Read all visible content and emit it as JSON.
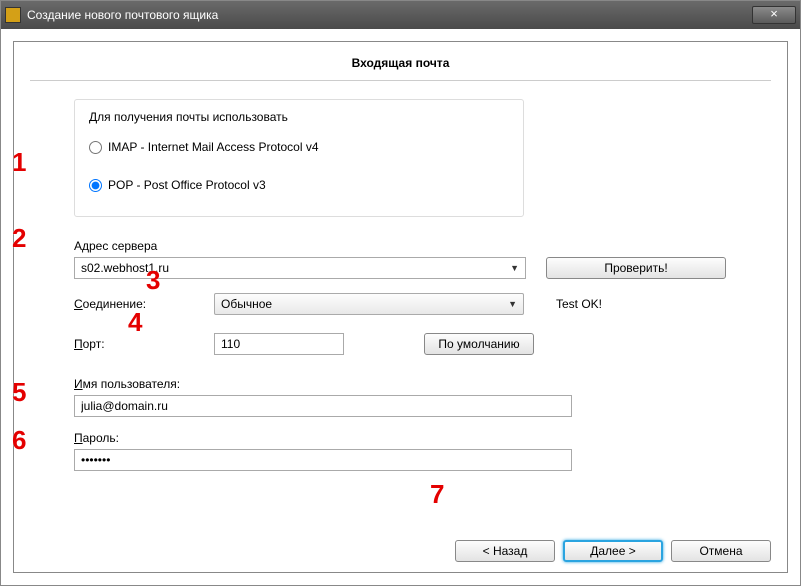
{
  "window": {
    "title": "Создание нового почтового ящика",
    "close": "×"
  },
  "header": "Входящая почта",
  "protocol": {
    "group_label": "Для получения почты использовать",
    "imap_label": "IMAP - Internet Mail Access Protocol v4",
    "pop_label": "POP  -  Post Office Protocol v3"
  },
  "server": {
    "label": "Адрес сервера",
    "value": "s02.webhost1.ru",
    "verify_btn": "Проверить!"
  },
  "connection": {
    "label": "Соединение:",
    "value": "Обычное",
    "status": "Test OK!"
  },
  "port": {
    "label": "Порт:",
    "value": "110",
    "default_btn": "По умолчанию"
  },
  "username": {
    "label": "Имя пользователя:",
    "value": "julia@domain.ru"
  },
  "password": {
    "label": "Пароль:",
    "value": "•••••••"
  },
  "buttons": {
    "back": "<  Назад",
    "next": "Далее  >",
    "cancel": "Отмена"
  },
  "markers": {
    "m1": "1",
    "m2": "2",
    "m3": "3",
    "m4": "4",
    "m5": "5",
    "m6": "6",
    "m7": "7"
  }
}
